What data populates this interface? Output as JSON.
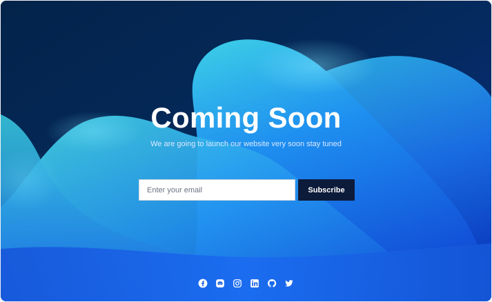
{
  "hero": {
    "title": "Coming Soon",
    "subtitle": "We are going to launch our website very soon stay tuned"
  },
  "subscribe_form": {
    "email_placeholder": "Enter your email",
    "email_value": "",
    "button_label": "Subscribe"
  },
  "social_links": [
    {
      "name": "facebook",
      "icon": "facebook-icon"
    },
    {
      "name": "discord",
      "icon": "discord-icon"
    },
    {
      "name": "instagram",
      "icon": "instagram-icon"
    },
    {
      "name": "linkedin",
      "icon": "linkedin-icon"
    },
    {
      "name": "github",
      "icon": "github-icon"
    },
    {
      "name": "twitter",
      "icon": "twitter-icon"
    }
  ],
  "colors": {
    "background_dark": "#04214a",
    "wave_blue": "#1d7cf0",
    "wave_cyan": "#33c8e8",
    "button_bg": "#0d1b3a",
    "text": "#ffffff"
  }
}
